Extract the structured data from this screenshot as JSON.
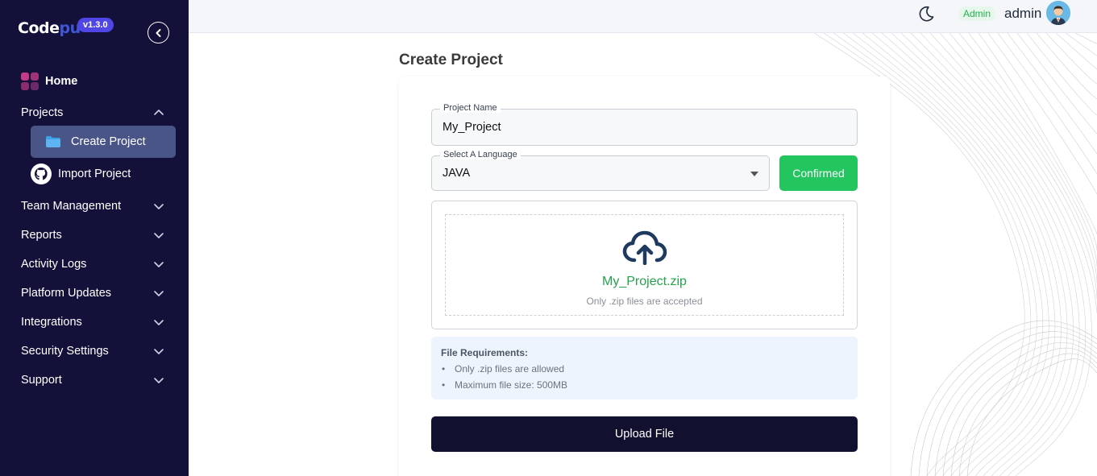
{
  "brand": {
    "name_part1": "Code",
    "name_part2": "pu",
    "version": "v1.3.0"
  },
  "sidebar": {
    "home": "Home",
    "projects": "Projects",
    "create_project": "Create Project",
    "import_project": "Import Project",
    "items": [
      {
        "label": "Team Management"
      },
      {
        "label": "Reports"
      },
      {
        "label": "Activity Logs"
      },
      {
        "label": "Platform Updates"
      },
      {
        "label": "Integrations"
      },
      {
        "label": "Security Settings"
      },
      {
        "label": "Support"
      }
    ]
  },
  "header": {
    "role": "Admin",
    "username": "admin"
  },
  "page": {
    "title": "Create Project"
  },
  "form": {
    "project_name_label": "Project Name",
    "project_name_value": "My_Project",
    "language_label": "Select A Language",
    "language_value": "JAVA",
    "confirm_label": "Confirmed",
    "file_name": "My_Project.zip",
    "file_hint": "Only .zip files are accepted",
    "requirements_title": "File Requirements:",
    "requirements": [
      "Only .zip files are allowed",
      "Maximum file size: 500MB"
    ],
    "upload_label": "Upload File"
  },
  "colors": {
    "sidebar_bg": "#13103a",
    "active_item_bg": "#4a5587",
    "confirm_green": "#22c55e",
    "upload_btn_bg": "#11102e",
    "file_name_green": "#22a34a"
  }
}
